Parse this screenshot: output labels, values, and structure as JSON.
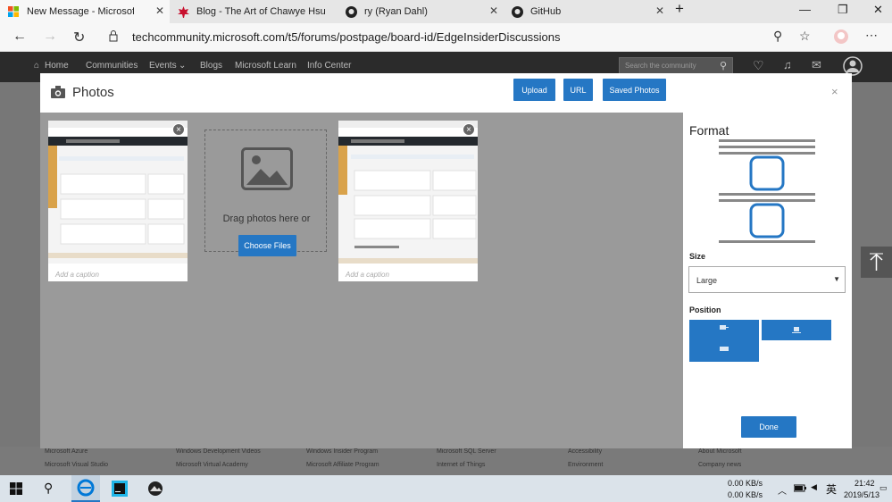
{
  "tabs": [
    {
      "title": "New Message - Microsoft Tech C",
      "icon": "microsoft-logo-icon"
    },
    {
      "title": "Blog - The Art of Chawye Hsu",
      "icon": "maple-leaf-icon"
    },
    {
      "title": "ry (Ryan Dahl)",
      "icon": "github-icon"
    },
    {
      "title": "GitHub",
      "icon": "github-icon"
    }
  ],
  "address": {
    "url": "techcommunity.microsoft.com/t5/forums/postpage/board-id/EdgeInsiderDiscussions"
  },
  "site_nav": {
    "home": "Home",
    "communities": "Communities",
    "events": "Events",
    "blogs": "Blogs",
    "learn": "Microsoft Learn",
    "info": "Info Center",
    "search_placeholder": "Search the community"
  },
  "modal": {
    "title": "Photos",
    "upload": "Upload",
    "url": "URL",
    "saved": "Saved Photos",
    "close": "×"
  },
  "cards": [
    {
      "caption": "Add a caption"
    },
    {
      "caption": "Add a caption"
    }
  ],
  "drop": {
    "text": "Drag photos here or",
    "button": "Choose Files"
  },
  "panel": {
    "format_title": "Format",
    "size_label": "Size",
    "size_value": "Large",
    "position_label": "Position",
    "done": "Done"
  },
  "footer": {
    "col1": [
      "Microsoft Azure",
      "Microsoft Visual Studio"
    ],
    "col2": [
      "Windows Development Videos",
      "Microsoft Virtual Academy"
    ],
    "col3": [
      "Windows Insider Program",
      "Microsoft Affiliate Program"
    ],
    "col4": [
      "Microsoft SQL Server",
      "Internet of Things"
    ],
    "col5": [
      "Accessibility",
      "Environment"
    ],
    "col6": [
      "About Microsoft",
      "Company news"
    ]
  },
  "taskbar": {
    "net_up": "0.00 KB/s",
    "net_down": "0.00 KB/s",
    "ime": "英",
    "time": "21:42",
    "date": "2019/5/13"
  },
  "colors": {
    "accent": "#2577c4",
    "site_bar": "#2b2b2b",
    "overlay": "#9a9a9a"
  }
}
